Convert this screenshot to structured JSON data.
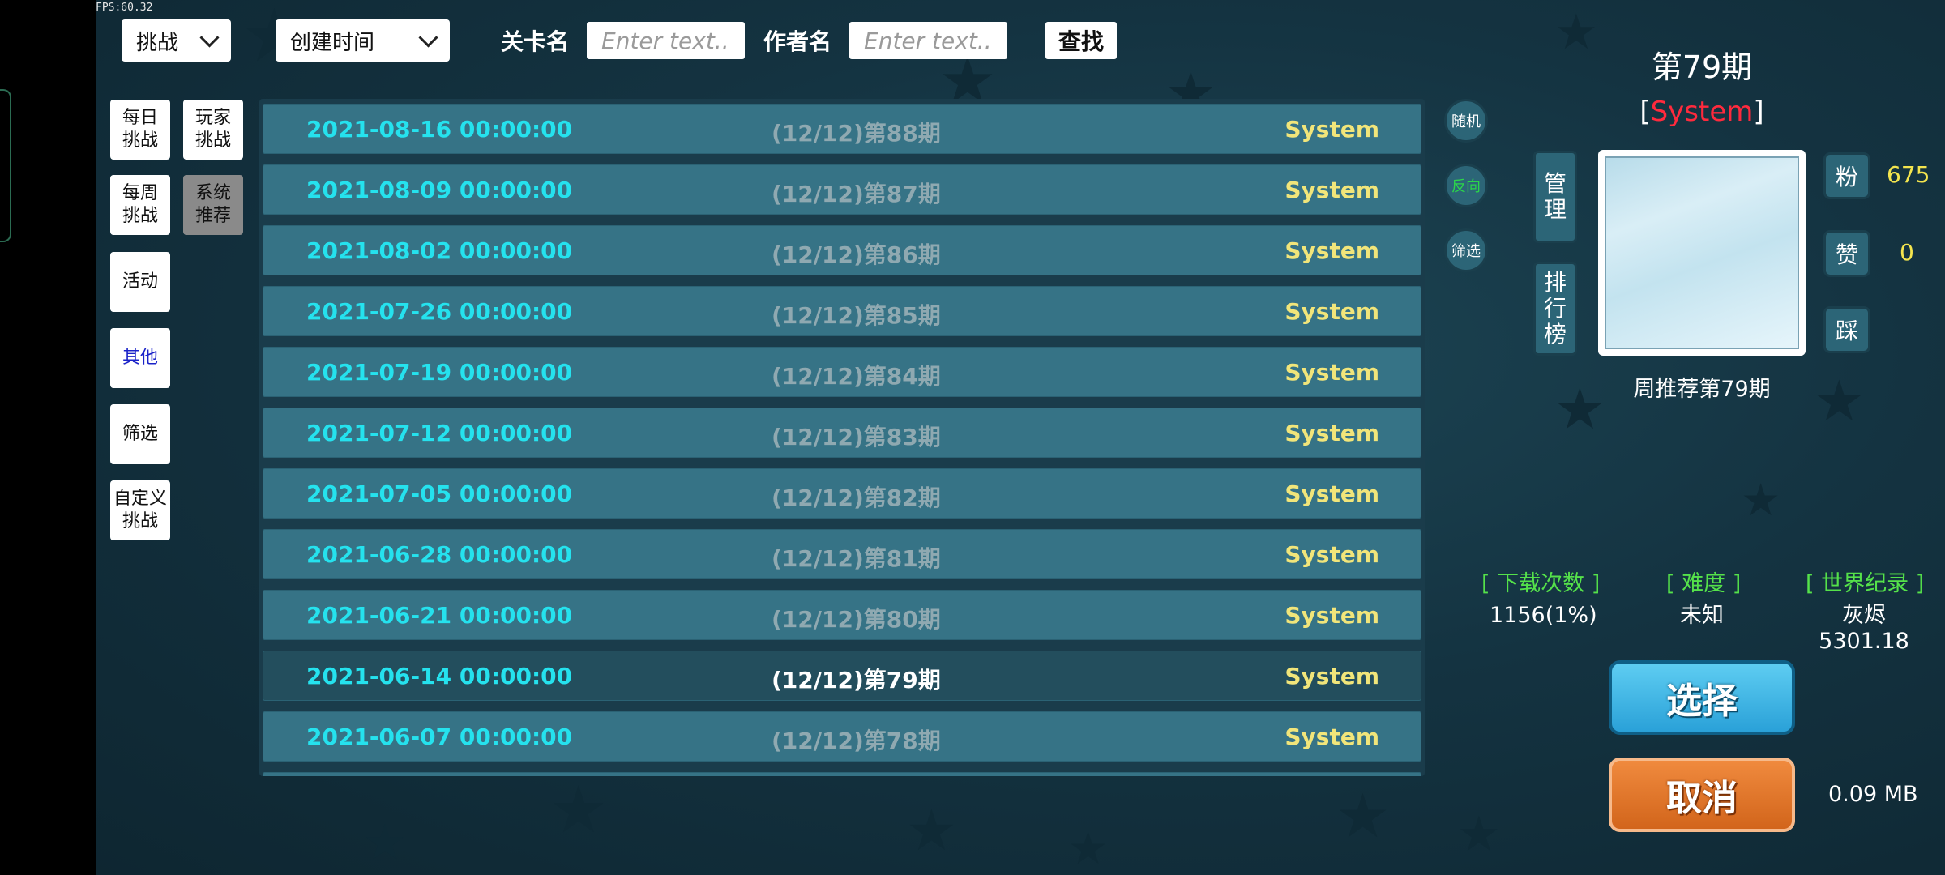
{
  "fps": "FPS:60.32",
  "topbar": {
    "type_dropdown": "挑战",
    "sort_dropdown": "创建时间",
    "level_label": "关卡名",
    "level_placeholder": "Enter text...",
    "author_label": "作者名",
    "author_placeholder": "Enter text...",
    "search_label": "查找"
  },
  "categories": [
    {
      "label": "每日\n挑战",
      "selected": false
    },
    {
      "label": "玩家\n挑战",
      "selected": false
    },
    {
      "label": "每周\n挑战",
      "selected": false
    },
    {
      "label": "系统\n推荐",
      "selected": true
    },
    {
      "label": "活动",
      "selected": false
    },
    {
      "label": "其他",
      "selected": false
    },
    {
      "label": "筛选",
      "selected": false
    },
    {
      "label": "自定义\n挑战",
      "selected": false
    }
  ],
  "list": [
    {
      "date": "2021-08-16 00:00:00",
      "title": "(12/12)第88期",
      "author": "System"
    },
    {
      "date": "2021-08-09 00:00:00",
      "title": "(12/12)第87期",
      "author": "System"
    },
    {
      "date": "2021-08-02 00:00:00",
      "title": "(12/12)第86期",
      "author": "System"
    },
    {
      "date": "2021-07-26 00:00:00",
      "title": "(12/12)第85期",
      "author": "System"
    },
    {
      "date": "2021-07-19 00:00:00",
      "title": "(12/12)第84期",
      "author": "System"
    },
    {
      "date": "2021-07-12 00:00:00",
      "title": "(12/12)第83期",
      "author": "System"
    },
    {
      "date": "2021-07-05 00:00:00",
      "title": "(12/12)第82期",
      "author": "System"
    },
    {
      "date": "2021-06-28 00:00:00",
      "title": "(12/12)第81期",
      "author": "System"
    },
    {
      "date": "2021-06-21 00:00:00",
      "title": "(12/12)第80期",
      "author": "System"
    },
    {
      "date": "2021-06-14 00:00:00",
      "title": "(12/12)第79期",
      "author": "System"
    },
    {
      "date": "2021-06-07 00:00:00",
      "title": "(12/12)第78期",
      "author": "System"
    }
  ],
  "round_buttons": {
    "random": "随机",
    "reverse": "反向",
    "filter": "筛选"
  },
  "colors": {
    "reverse_text": "#2bd64a",
    "author_name": "#ff2a3d",
    "stat_value": "#f4e54e",
    "info_label": "#55e24a"
  },
  "detail": {
    "title": "第79期",
    "author_open": "[",
    "author_name": "System",
    "author_close": "]",
    "manage_label": [
      "管",
      "理"
    ],
    "rank_label": [
      "排",
      "行",
      "榜"
    ],
    "caption": "周推荐第79期",
    "fans_label": "粉",
    "fans_value": "675",
    "likes_label": "赞",
    "likes_value": "0",
    "dislike_label": "踩",
    "downloads_label": "[ 下载次数 ]",
    "downloads_value": "1156(1%)",
    "difficulty_label": "[ 难度 ]",
    "difficulty_value": "未知",
    "record_label": "[ 世界纪录 ]",
    "record_holder": "灰烬",
    "record_value": "5301.18",
    "select_label": "选择",
    "cancel_label": "取消",
    "file_size": "0.09 MB"
  }
}
